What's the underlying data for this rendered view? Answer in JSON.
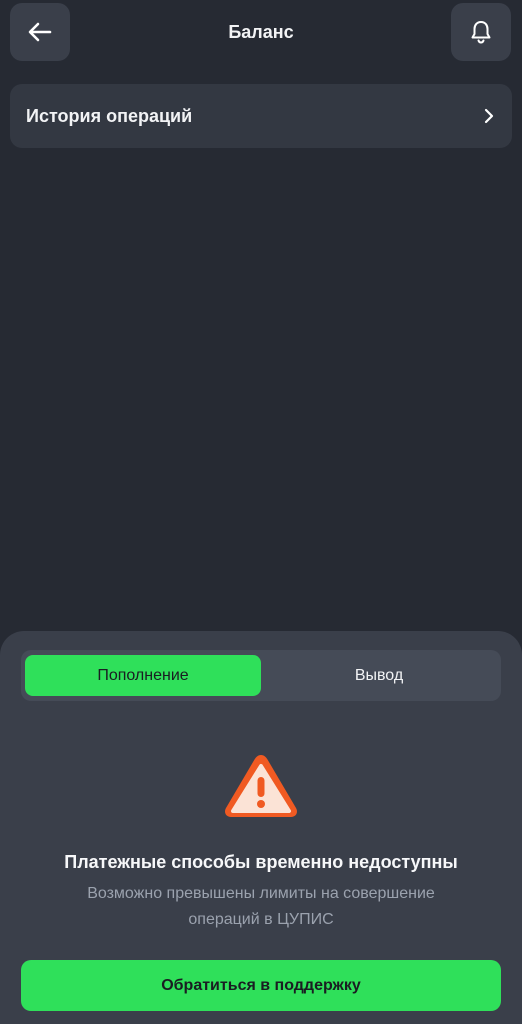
{
  "header": {
    "title": "Баланс",
    "back_icon": "arrow-left-icon",
    "notifications_icon": "bell-icon"
  },
  "history": {
    "label": "История операций",
    "icon": "chevron-right-icon"
  },
  "sheet": {
    "tabs": [
      {
        "label": "Пополнение",
        "active": true
      },
      {
        "label": "Вывод",
        "active": false
      }
    ],
    "warning_icon": "warning-triangle-icon",
    "notice_title": "Платежные способы временно недоступны",
    "notice_text_line1": "Возможно превышены лимиты на совершение",
    "notice_text_line2": "операций в ЦУПИС",
    "support_button": "Обратиться в поддержку"
  },
  "colors": {
    "background": "#262a33",
    "card": "#333842",
    "sheet": "#3a3f4a",
    "accent_green": "#2fe05a",
    "warning_orange": "#f05a22"
  }
}
